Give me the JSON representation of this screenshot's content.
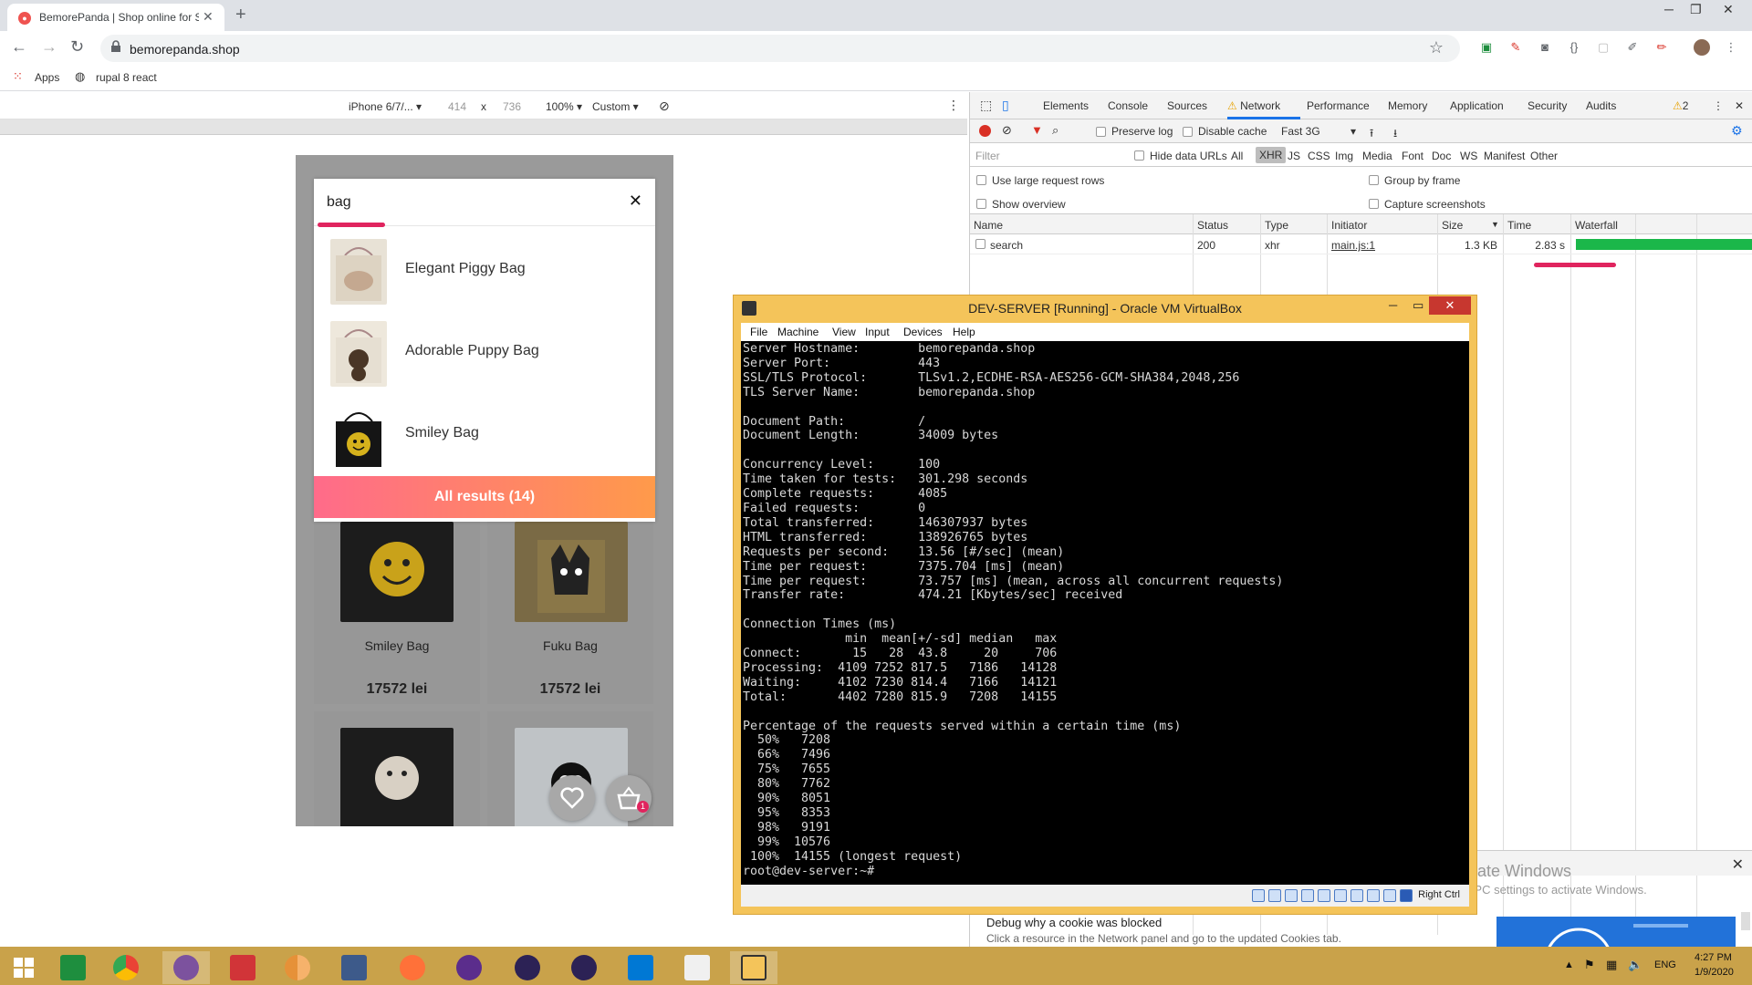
{
  "browser": {
    "tab_title": "BemorePanda | Shop online for S",
    "url": "bemorepanda.shop",
    "bookmarks": [
      "Apps",
      "rupal 8 react"
    ]
  },
  "device_toolbar": {
    "device": "iPhone 6/7/...",
    "width": "414",
    "times": "x",
    "height": "736",
    "zoom": "100%",
    "throttle": "Custom"
  },
  "page": {
    "search": {
      "value": "bag",
      "suggestions": [
        {
          "name": "Elegant Piggy Bag"
        },
        {
          "name": "Adorable Puppy Bag"
        },
        {
          "name": "Smiley Bag"
        }
      ],
      "all_results": "All results (14)"
    },
    "products": [
      {
        "name": "Smiley Bag",
        "price": "17572 lei"
      },
      {
        "name": "Fuku Bag",
        "price": "17572 lei"
      }
    ],
    "cart_badge": "1"
  },
  "devtools": {
    "tabs": [
      "Elements",
      "Console",
      "Sources",
      "Network",
      "Performance",
      "Memory",
      "Application",
      "Security",
      "Audits"
    ],
    "warn_count": "2",
    "toolbar": {
      "preserve_log": "Preserve log",
      "disable_cache": "Disable cache",
      "throttle": "Fast 3G"
    },
    "filter": {
      "placeholder": "Filter",
      "hide_data_urls": "Hide data URLs",
      "types": [
        "All",
        "XHR",
        "JS",
        "CSS",
        "Img",
        "Media",
        "Font",
        "Doc",
        "WS",
        "Manifest",
        "Other"
      ]
    },
    "options": {
      "large_rows": "Use large request rows",
      "group_by_frame": "Group by frame",
      "overview": "Show overview",
      "screenshots": "Capture screenshots"
    },
    "columns": [
      "Name",
      "Status",
      "Type",
      "Initiator",
      "Size",
      "Time",
      "Waterfall"
    ],
    "row": {
      "name": "search",
      "status": "200",
      "type": "xhr",
      "initiator": "main.js:1",
      "size": "1.3 KB",
      "time": "2.83 s"
    },
    "drawer": {
      "title": "Debug why a cookie was blocked",
      "desc": "Click a resource in the Network panel and go to the updated Cookies tab."
    }
  },
  "activate": {
    "title": "Activate Windows",
    "sub": "Go to PC settings to activate Windows."
  },
  "vbox": {
    "title": "DEV-SERVER [Running] - Oracle VM VirtualBox",
    "menu": [
      "File",
      "Machine",
      "View",
      "Input",
      "Devices",
      "Help"
    ],
    "right_ctrl": "Right Ctrl",
    "terminal": "Server Hostname:        bemorepanda.shop\nServer Port:            443\nSSL/TLS Protocol:       TLSv1.2,ECDHE-RSA-AES256-GCM-SHA384,2048,256\nTLS Server Name:        bemorepanda.shop\n\nDocument Path:          /\nDocument Length:        34009 bytes\n\nConcurrency Level:      100\nTime taken for tests:   301.298 seconds\nComplete requests:      4085\nFailed requests:        0\nTotal transferred:      146307937 bytes\nHTML transferred:       138926765 bytes\nRequests per second:    13.56 [#/sec] (mean)\nTime per request:       7375.704 [ms] (mean)\nTime per request:       73.757 [ms] (mean, across all concurrent requests)\nTransfer rate:          474.21 [Kbytes/sec] received\n\nConnection Times (ms)\n              min  mean[+/-sd] median   max\nConnect:       15   28  43.8     20     706\nProcessing:  4109 7252 817.5   7186   14128\nWaiting:     4102 7230 814.4   7166   14121\nTotal:       4402 7280 815.9   7208   14155\n\nPercentage of the requests served within a certain time (ms)\n  50%   7208\n  66%   7496\n  75%   7655\n  80%   7762\n  90%   8051\n  95%   8353\n  98%   9191\n  99%  10576\n 100%  14155 (longest request)\nroot@dev-server:~#"
  },
  "taskbar": {
    "lang": "ENG",
    "time": "4:27 PM",
    "date": "1/9/2020"
  },
  "colors": {
    "accent_pink": "#e0245e",
    "cta_start": "#ff6b8a",
    "cta_end": "#ff9a4a",
    "waterfall": "#1bb74a",
    "vbox_frame": "#f4c45a",
    "taskbar": "#c9a24a"
  }
}
